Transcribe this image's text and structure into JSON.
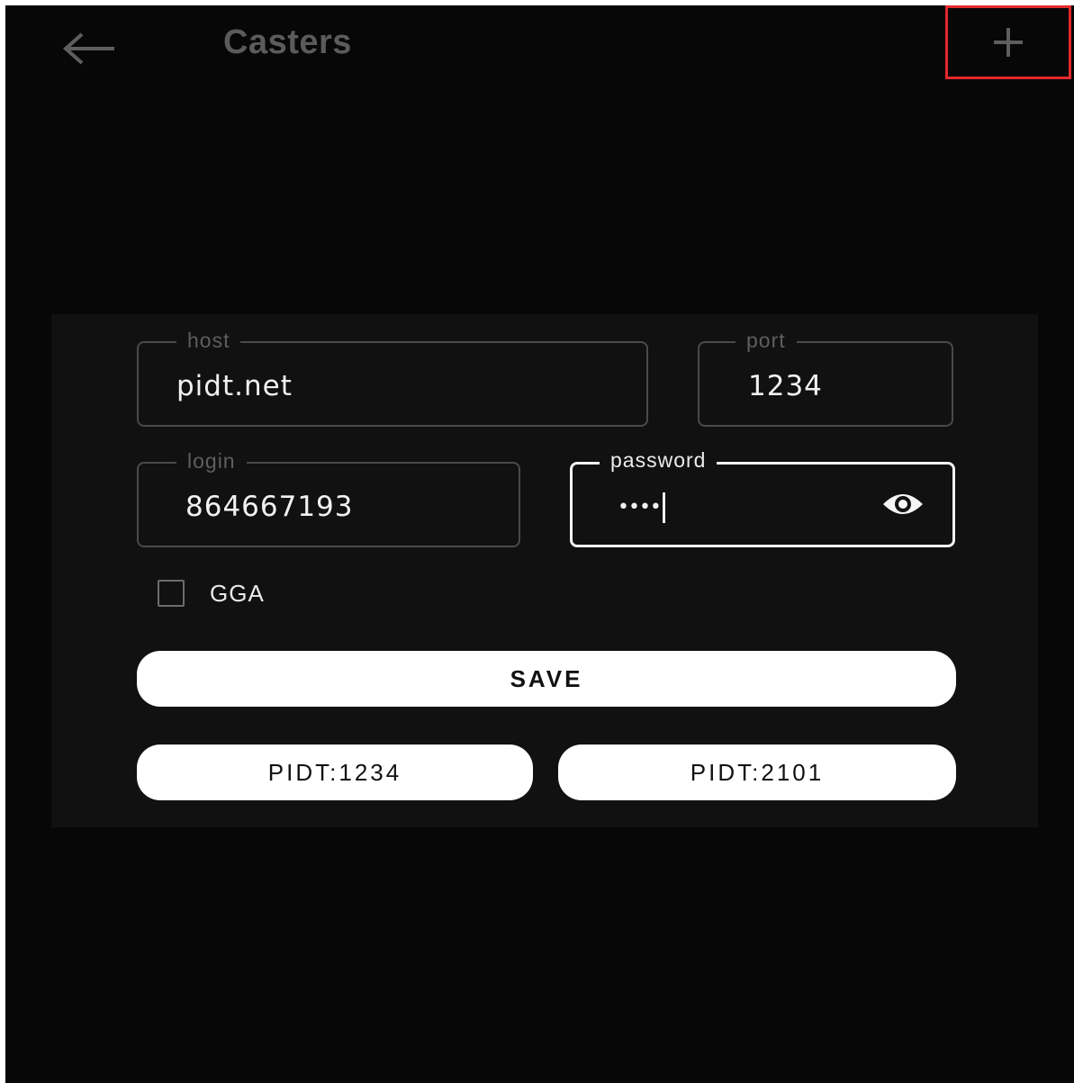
{
  "appbar": {
    "title": "Casters",
    "back_icon": "arrow-left-icon",
    "add_icon": "plus-icon",
    "highlight_color": "#e3282c"
  },
  "form": {
    "host": {
      "label": "host",
      "value": "pidt.net"
    },
    "port": {
      "label": "port",
      "value": "1234"
    },
    "login": {
      "label": "login",
      "value": "864667193"
    },
    "password": {
      "label": "password",
      "value": "••••",
      "toggle_icon": "eye-icon"
    },
    "gga": {
      "label": "GGA",
      "checked": false
    },
    "save_label": "SAVE",
    "presets": [
      {
        "label": "PIDT:1234"
      },
      {
        "label": "PIDT:2101"
      }
    ]
  }
}
